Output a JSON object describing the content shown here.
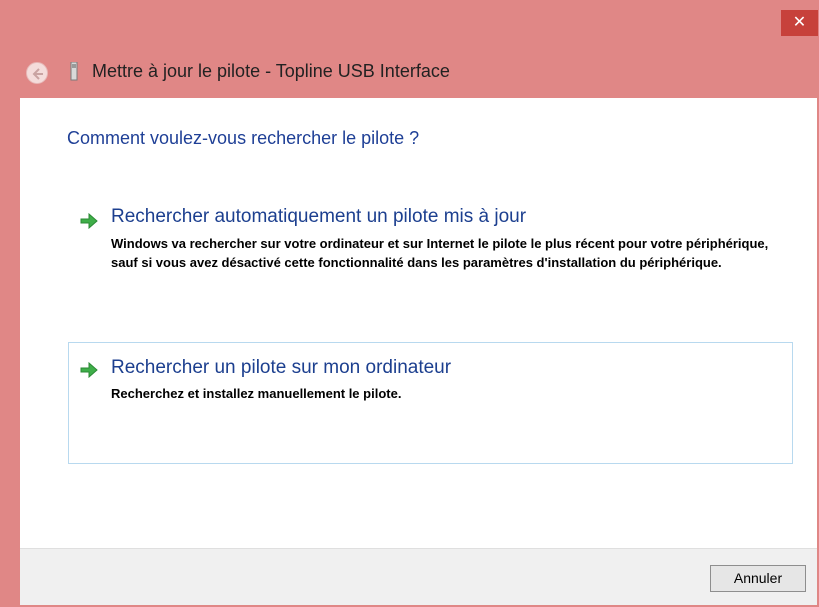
{
  "window": {
    "title": "Mettre à jour le pilote - Topline USB Interface",
    "close_glyph": "✕",
    "accent_color": "#e08786"
  },
  "content": {
    "heading": "Comment voulez-vous rechercher le pilote ?",
    "options": [
      {
        "icon": "green-arrow-icon",
        "title": "Rechercher automatiquement un pilote mis à jour",
        "description": "Windows va rechercher sur votre ordinateur et sur Internet le pilote le plus récent pour votre périphérique, sauf si vous avez désactivé cette fonctionnalité dans les paramètres d'installation du périphérique."
      },
      {
        "icon": "green-arrow-icon",
        "title": "Rechercher un pilote sur mon ordinateur",
        "description": "Recherchez et installez manuellement le pilote."
      }
    ]
  },
  "footer": {
    "cancel_label": "Annuler"
  }
}
